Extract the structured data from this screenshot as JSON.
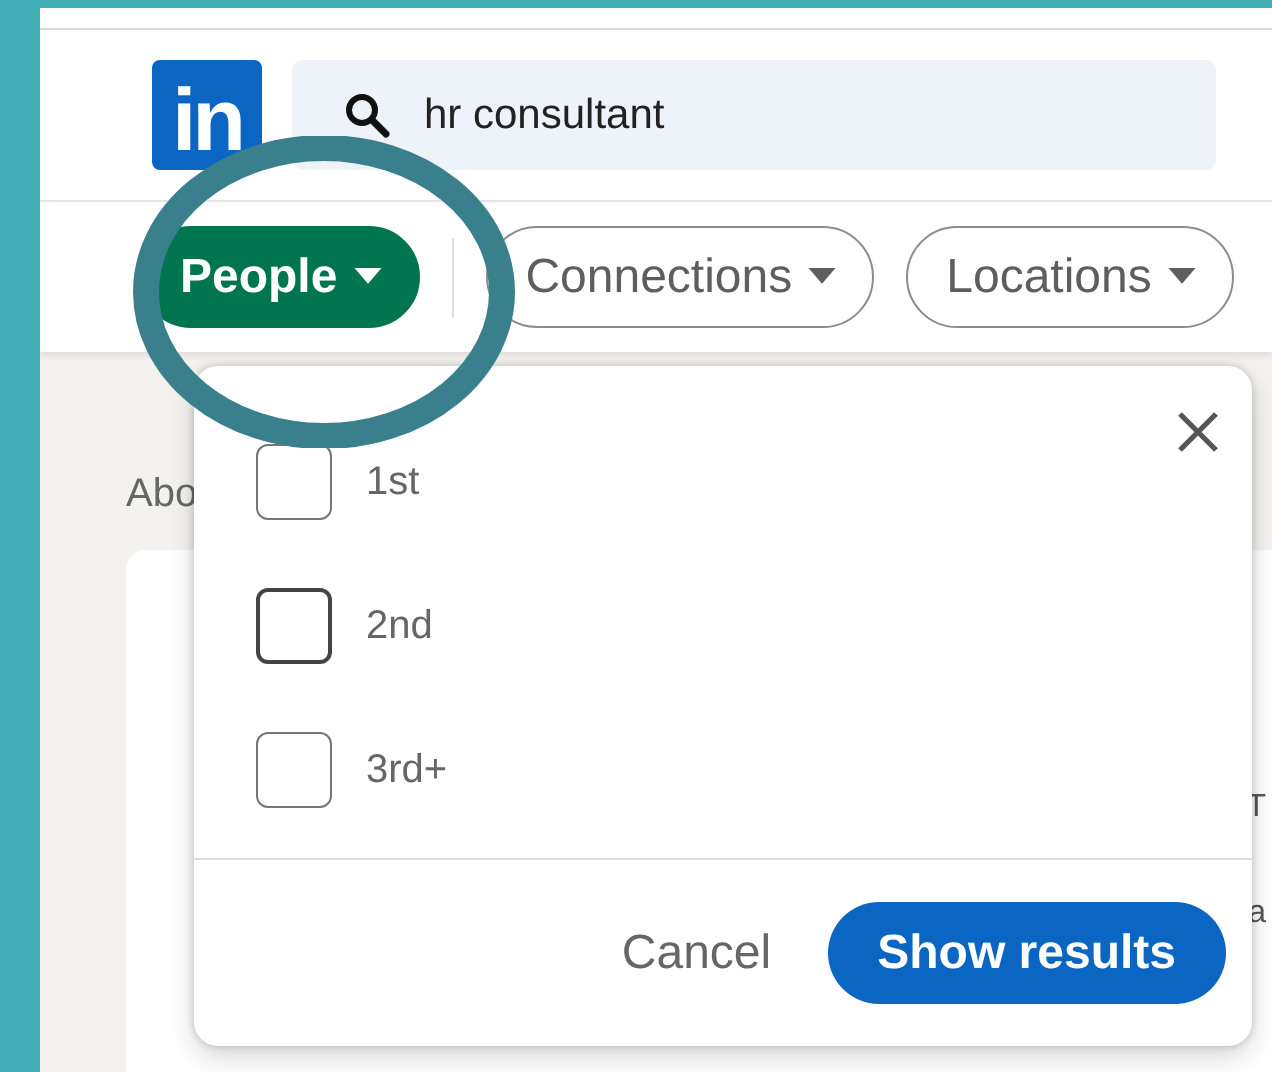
{
  "logo": {
    "text": "in"
  },
  "search": {
    "value": "hr consultant"
  },
  "filters": [
    {
      "label": "People",
      "selected": true
    },
    {
      "label": "Connections",
      "selected": false
    },
    {
      "label": "Locations",
      "selected": false
    }
  ],
  "background": {
    "heading": "Abo",
    "fragments": [
      "T",
      "a"
    ]
  },
  "dropdown": {
    "options": [
      {
        "label": "1st",
        "checked": false,
        "hovered": false
      },
      {
        "label": "2nd",
        "checked": false,
        "hovered": true
      },
      {
        "label": "3rd+",
        "checked": false,
        "hovered": false
      }
    ],
    "cancel": "Cancel",
    "submit": "Show results"
  },
  "annotation": {
    "kind": "circle"
  }
}
